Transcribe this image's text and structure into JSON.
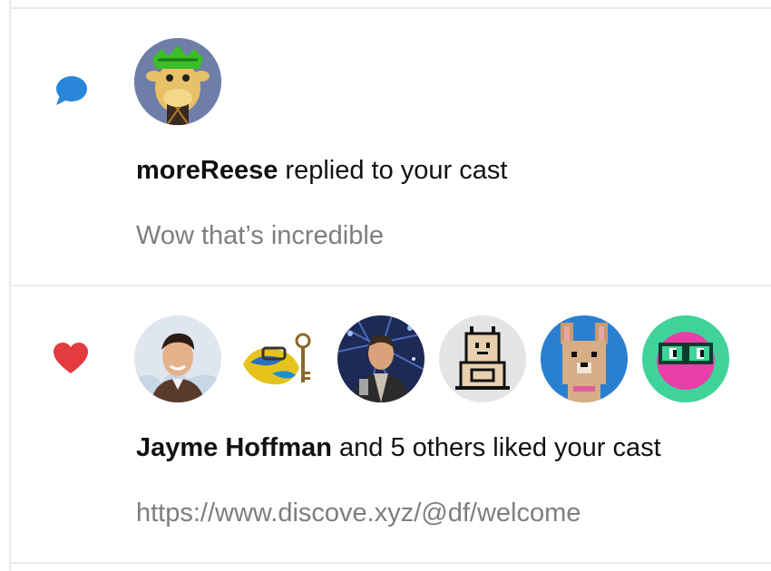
{
  "colors": {
    "divider": "#e6ebf1",
    "reply_icon": "#2a86d9",
    "like_icon": "#e33b40",
    "preview_text": "#7e7e80",
    "headline_text": "#111111"
  },
  "notifications": [
    {
      "type": "reply",
      "icon": "speech-bubble-icon",
      "avatars": [
        "giraffe-avatar"
      ],
      "user": "moreReese",
      "action": " replied to your cast",
      "preview": "Wow that’s incredible"
    },
    {
      "type": "like",
      "icon": "heart-icon",
      "avatars": [
        "man-portrait-avatar",
        "yellow-key-creature-avatar",
        "man-at-event-avatar",
        "pixel-robot-avatar",
        "pixel-dog-avatar",
        "pink-glasses-avatar"
      ],
      "user": "Jayme Hoffman",
      "action": " and 5 others liked your cast",
      "preview": "https://www.discove.xyz/@df/welcome"
    }
  ]
}
